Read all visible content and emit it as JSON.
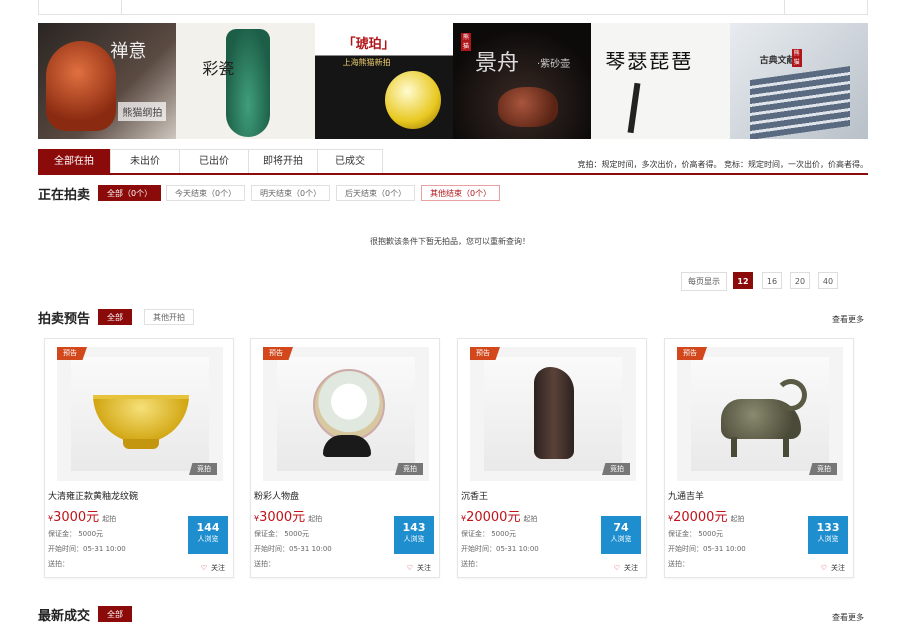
{
  "banner": [
    {
      "text": "禅意",
      "sub": "熊猫纲拍"
    },
    {
      "text": "彩瓷",
      "sub": ""
    },
    {
      "text": "「琥珀」",
      "sub": "上海熊猫新拍"
    },
    {
      "text": "景舟",
      "sub": "·紫砂壶"
    },
    {
      "text": "琴瑟琵琶",
      "sub": ""
    },
    {
      "text": "古典文献",
      "sub": ""
    }
  ],
  "tabs": [
    "全部在拍",
    "未出价",
    "已出价",
    "即将开拍",
    "已成交"
  ],
  "rules_text": "竞拍：规定时间，多次出价，价高者得。 竞标：规定时间，一次出价，价高者得。",
  "ongoing": {
    "title": "正在拍卖",
    "filters": [
      "全部（0个）",
      "今天结束（0个）",
      "明天结束（0个）",
      "后天结束（0个）",
      "其他结束（0个）"
    ],
    "empty_text": "很抱歉该条件下暂无拍品，您可以重新查询！",
    "per_page_label": "每页显示",
    "page_sizes": [
      "12",
      "16",
      "20",
      "40"
    ],
    "selected_page_size": "12"
  },
  "preview": {
    "title": "拍卖预告",
    "filters": [
      "全部",
      "其他开拍"
    ],
    "more": "查看更多",
    "items": [
      {
        "flag": "预告",
        "badge": "竞拍",
        "name": "大清雍正款黄釉龙纹碗",
        "currency": "¥",
        "price": "3000元",
        "unit": "起拍",
        "deposit": "保证金： 5000元",
        "start": "开始时间：05-31 10:00",
        "send": "送拍：",
        "views": "144",
        "views_label": "人浏览",
        "follow": "关注"
      },
      {
        "flag": "预告",
        "badge": "竞拍",
        "name": "粉彩人物盘",
        "currency": "¥",
        "price": "3000元",
        "unit": "起拍",
        "deposit": "保证金： 5000元",
        "start": "开始时间：05-31 10:00",
        "send": "送拍：",
        "views": "143",
        "views_label": "人浏览",
        "follow": "关注"
      },
      {
        "flag": "预告",
        "badge": "竞拍",
        "name": "沉香王",
        "currency": "¥",
        "price": "20000元",
        "unit": "起拍",
        "deposit": "保证金： 5000元",
        "start": "开始时间：05-31 10:00",
        "send": "送拍：",
        "views": "74",
        "views_label": "人浏览",
        "follow": "关注"
      },
      {
        "flag": "预告",
        "badge": "竞拍",
        "name": "九通吉羊",
        "currency": "¥",
        "price": "20000元",
        "unit": "起拍",
        "deposit": "保证金： 5000元",
        "start": "开始时间：05-31 10:00",
        "send": "送拍：",
        "views": "133",
        "views_label": "人浏览",
        "follow": "关注"
      }
    ]
  },
  "latest": {
    "title": "最新成交",
    "filter": "全部",
    "more": "查看更多"
  },
  "colors": {
    "brand": "#8b0a0a",
    "price": "#c0131a",
    "views": "#1e8ecf",
    "flag": "#d2471c"
  }
}
